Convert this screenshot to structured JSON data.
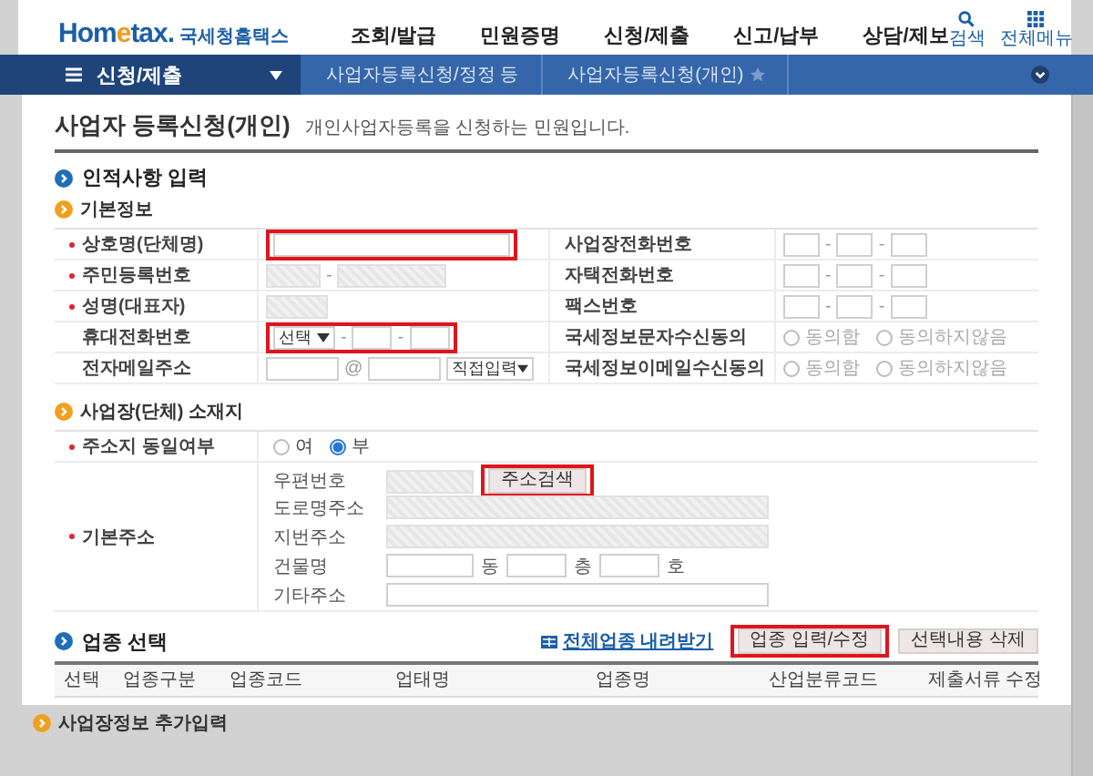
{
  "header": {
    "logo": {
      "brand": [
        "Hom",
        "e",
        "tax."
      ],
      "name": "국세청홈택스"
    },
    "menu": [
      "조회/발급",
      "민원증명",
      "신청/제출",
      "신고/납부",
      "상담/제보"
    ],
    "tools": [
      {
        "label": "검색",
        "kind": "search"
      },
      {
        "label": "전체메뉴",
        "kind": "menu"
      }
    ]
  },
  "breadcrumb": {
    "menu": "신청/제출",
    "items": [
      "사업자등록신청/정정 등",
      "사업자등록신청(개인)"
    ]
  },
  "page": {
    "title": "사업자 등록신청(개인)",
    "description": "개인사업자등록을 신청하는 민원입니다."
  },
  "personal": {
    "title": "인적사항 입력",
    "subtitle": "기본정보",
    "rows": [
      {
        "left": {
          "label": "상호명(단체명)",
          "required": true,
          "kind": "text",
          "highlighted": true
        },
        "right": {
          "label": "사업장전화번호",
          "kind": "phone",
          "separator": "-"
        }
      },
      {
        "left": {
          "label": "주민등록번호",
          "required": true,
          "kind": "resident",
          "separator": "-",
          "highlighted": false
        },
        "right": {
          "label": "자택전화번호",
          "kind": "phone",
          "separator": "-"
        }
      },
      {
        "left": {
          "label": "성명(대표자)",
          "required": true,
          "kind": "readonly",
          "highlighted": false
        },
        "right": {
          "label": "팩스번호",
          "kind": "phone",
          "separator": "-"
        }
      },
      {
        "left": {
          "label": "휴대전화번호",
          "required": false,
          "kind": "mobile",
          "select": "선택",
          "separator": "-",
          "highlighted": true
        },
        "right": {
          "label": "국세정보문자수신동의",
          "kind": "consent",
          "options": [
            {
              "label": "동의함",
              "selected": false,
              "disabled": true
            },
            {
              "label": "동의하지않음",
              "selected": false,
              "disabled": true
            }
          ]
        }
      },
      {
        "left": {
          "label": "전자메일주소",
          "required": false,
          "kind": "email",
          "at": "@",
          "select": "직접입력",
          "highlighted": false
        },
        "right": {
          "label": "국세정보이메일수신동의",
          "kind": "consent",
          "options": [
            {
              "label": "동의함",
              "selected": false,
              "disabled": true
            },
            {
              "label": "동의하지않음",
              "selected": false,
              "disabled": true
            }
          ]
        }
      }
    ]
  },
  "location": {
    "subtitle": "사업장(단체) 소재지",
    "same_address": {
      "label": "주소지 동일여부",
      "required": true,
      "options": [
        {
          "label": "여",
          "selected": false,
          "disabled": false
        },
        {
          "label": "부",
          "selected": true,
          "disabled": false
        }
      ]
    },
    "address": {
      "label": "기본주소",
      "required": true,
      "rows": [
        {
          "label": "우편번호",
          "kind": "postcode",
          "button": {
            "label": "주소검색",
            "highlighted": true
          }
        },
        {
          "label": "도로명주소",
          "kind": "readonly"
        },
        {
          "label": "지번주소",
          "kind": "readonly"
        },
        {
          "label": "건물명",
          "kind": "building",
          "units": [
            "동",
            "층",
            "호"
          ]
        },
        {
          "label": "기타주소",
          "kind": "text"
        }
      ]
    }
  },
  "industry": {
    "title": "업종 선택",
    "download_link": "전체업종 내려받기",
    "buttons": [
      {
        "label": "업종 입력/수정",
        "highlighted": true
      },
      {
        "label": "선택내용 삭제",
        "highlighted": false
      }
    ],
    "columns": [
      "선택",
      "업종구분",
      "업종코드",
      "업태명",
      "업종명",
      "산업분류코드",
      "제출서류",
      "수정"
    ]
  },
  "next_section": "사업장정보 추가입력"
}
